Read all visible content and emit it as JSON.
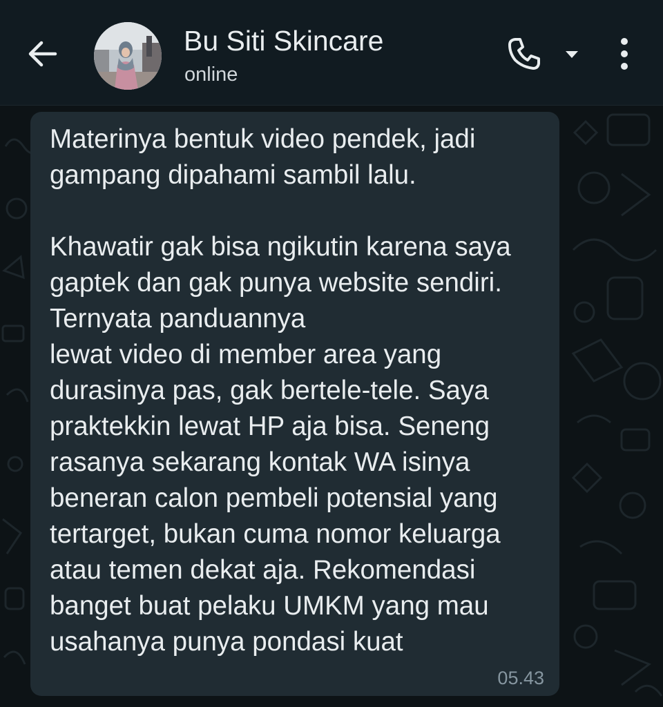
{
  "header": {
    "contact_name": "Bu Siti Skincare",
    "status": "online",
    "back_icon": "arrow-left-icon",
    "call_icon": "phone-icon",
    "call_dropdown_icon": "caret-down-icon",
    "menu_icon": "more-vertical-icon"
  },
  "message": {
    "text": "Materinya bentuk video pendek, jadi gampang dipahami sambil lalu.\n\nKhawatir gak bisa ngikutin karena saya gaptek dan gak punya website sendiri. Ternyata panduannya\nlewat video di member area yang durasinya pas, gak bertele-tele. Saya praktekkin lewat HP aja bisa. Seneng rasanya sekarang kontak WA isinya beneran calon pembeli potensial yang tertarget, bukan cuma nomor keluarga atau temen dekat aja. Rekomendasi banget buat pelaku UMKM yang mau usahanya punya pondasi kuat",
    "time": "05.43"
  },
  "colors": {
    "header_bg": "#111b21",
    "bubble_bg": "#202c33",
    "text_primary": "#e9edef",
    "text_secondary": "#8696a0"
  }
}
